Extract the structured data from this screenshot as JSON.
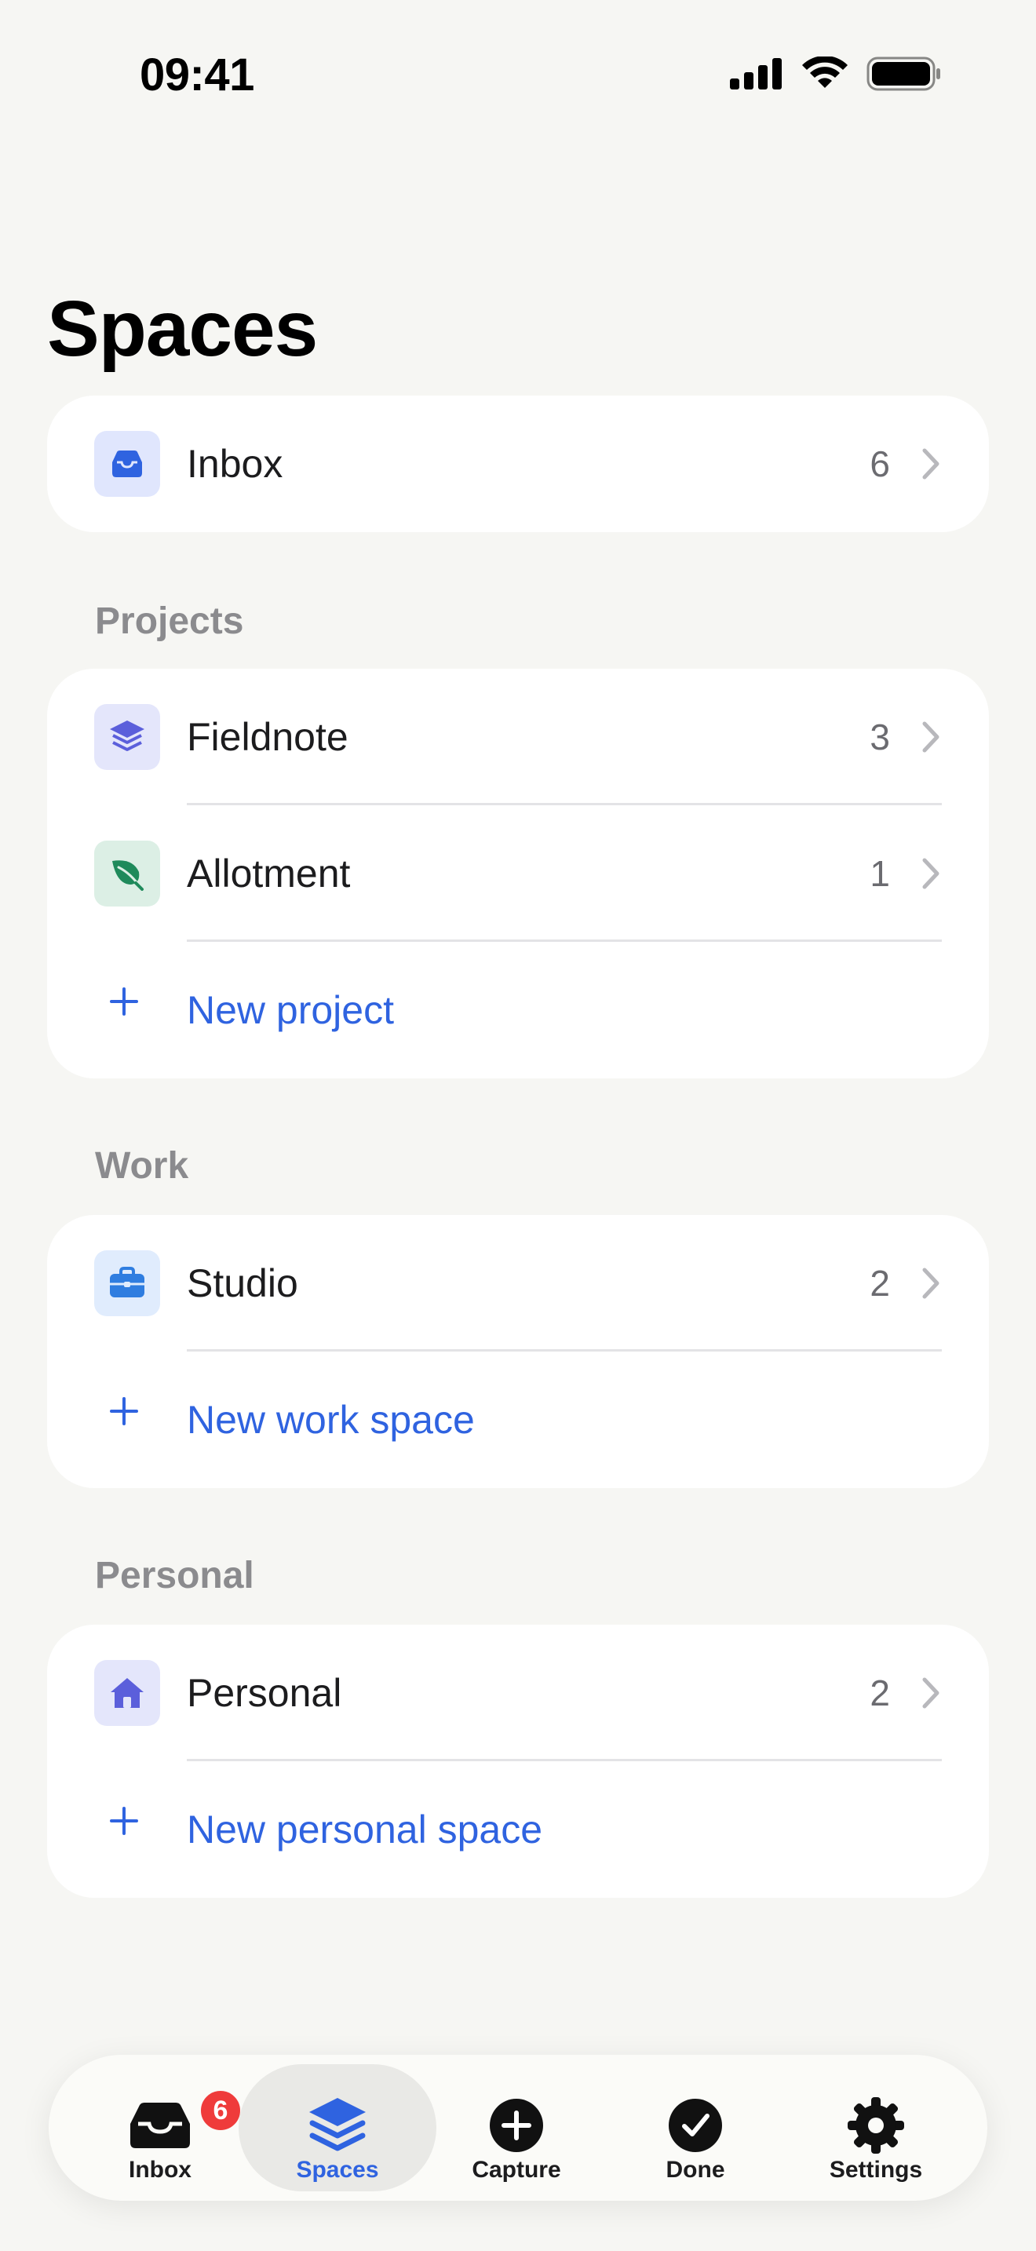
{
  "status_bar": {
    "time": "09:41"
  },
  "page": {
    "title": "Spaces"
  },
  "inbox_card": {
    "label": "Inbox",
    "count": "6",
    "icon": "inbox-tray-icon"
  },
  "projects": {
    "header": "Projects",
    "items": [
      {
        "label": "Fieldnote",
        "count": "3",
        "icon": "layers-icon",
        "icon_bg": "#e4e6fb",
        "icon_color": "#5b5fdb"
      },
      {
        "label": "Allotment",
        "count": "1",
        "icon": "leaf-icon",
        "icon_bg": "#dcefe5",
        "icon_color": "#1f8a5b"
      }
    ],
    "add_label": "New project"
  },
  "work": {
    "header": "Work",
    "items": [
      {
        "label": "Studio",
        "count": "2",
        "icon": "briefcase-icon",
        "icon_bg": "#e0ecfd",
        "icon_color": "#2f7de0"
      }
    ],
    "add_label": "New work space"
  },
  "personal": {
    "header": "Personal",
    "items": [
      {
        "label": "Personal",
        "count": "2",
        "icon": "home-icon",
        "icon_bg": "#e4e6fb",
        "icon_color": "#5b5fdb"
      }
    ],
    "add_label": "New personal space"
  },
  "tab_bar": {
    "tabs": [
      {
        "label": "Inbox",
        "icon": "inbox-tray-icon",
        "badge": "6"
      },
      {
        "label": "Spaces",
        "icon": "layers-icon",
        "active": true
      },
      {
        "label": "Capture",
        "icon": "plus-circle-icon"
      },
      {
        "label": "Done",
        "icon": "check-circle-icon"
      },
      {
        "label": "Settings",
        "icon": "gear-icon"
      }
    ]
  },
  "colors": {
    "accent": "#2f63e0",
    "badge": "#ef3b3b",
    "background": "#f6f6f3"
  }
}
